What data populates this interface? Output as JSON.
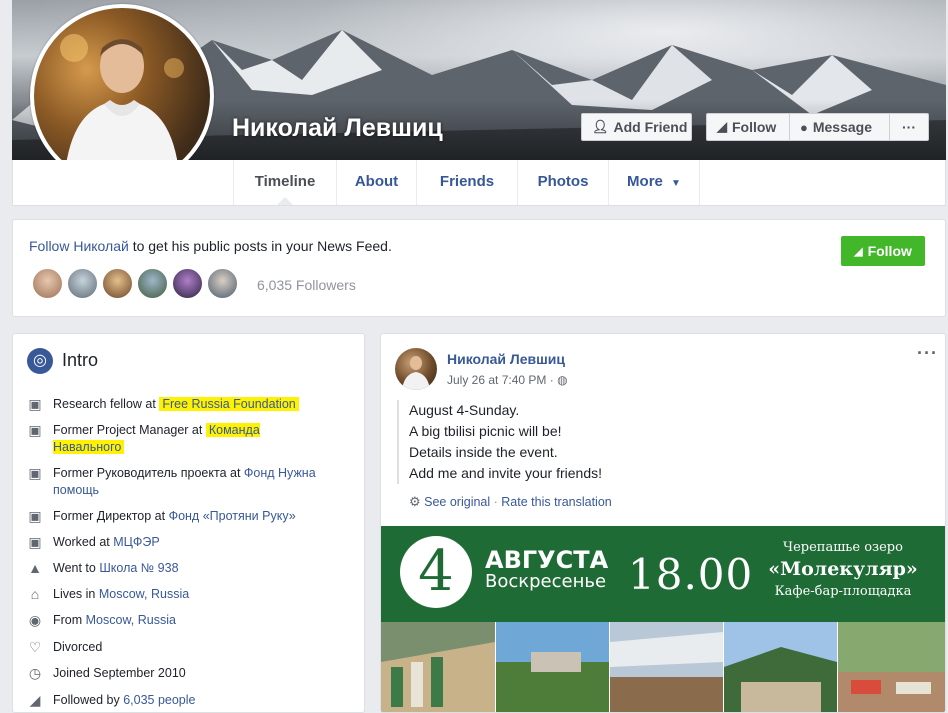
{
  "profile": {
    "name": "Николай Левшиц",
    "buttons": {
      "add_friend": "Add Friend",
      "follow": "Follow",
      "message": "Message",
      "more": "···"
    },
    "tabs": [
      {
        "label": "Timeline",
        "active": true
      },
      {
        "label": "About"
      },
      {
        "label": "Friends"
      },
      {
        "label": "Photos"
      },
      {
        "label": "More"
      }
    ]
  },
  "follow_card": {
    "link_text": "Follow Николай",
    "rest_text": " to get his public posts in your News Feed.",
    "button": "Follow",
    "followers": "6,035 Followers",
    "button_color": "#42b72a"
  },
  "intro": {
    "title": "Intro",
    "items": [
      {
        "icon": "briefcase-icon",
        "prefix": "Research fellow at ",
        "link": "Free Russia Foundation",
        "highlight": true
      },
      {
        "icon": "briefcase-icon",
        "prefix": "Former Project Manager at ",
        "link": "Команда Навального",
        "highlight": true
      },
      {
        "icon": "briefcase-icon",
        "prefix": "Former Руководитель проекта at ",
        "link": "Фонд Нужна помощь"
      },
      {
        "icon": "briefcase-icon",
        "prefix": "Former Директор at ",
        "link": "Фонд «Протяни Руку»"
      },
      {
        "icon": "briefcase-icon",
        "prefix": "Worked at ",
        "link": "МЦФЭР"
      },
      {
        "icon": "graduation-cap-icon",
        "prefix": "Went to ",
        "link": "Школа № 938"
      },
      {
        "icon": "house-icon",
        "prefix": "Lives in ",
        "link": "Moscow, Russia"
      },
      {
        "icon": "location-pin-icon",
        "prefix": "From ",
        "link": "Moscow, Russia"
      },
      {
        "icon": "heart-icon",
        "prefix": "Divorced",
        "link": ""
      },
      {
        "icon": "clock-icon",
        "prefix": "Joined September 2010",
        "link": ""
      },
      {
        "icon": "rss-icon",
        "prefix": "Followed by ",
        "link": "6,035 people"
      }
    ]
  },
  "post": {
    "author": "Николай Левшиц",
    "date": "July 26 at 7:40 PM · ",
    "lines": [
      "August 4-Sunday.",
      "A big tbilisi picnic will be!",
      "Details inside the event.",
      "Add me and invite your friends!"
    ],
    "see_original": "See original",
    "separator": " · ",
    "rate": "Rate this translation",
    "banner": {
      "day_number": "4",
      "month": "АВГУСТА",
      "weekday": "Воскресенье",
      "time": "18.00",
      "lake": "Черепашье озеро",
      "venue": "«Молекуляр»",
      "cafe": "Кафе-бар-площадка",
      "color": "#1f6b35"
    }
  }
}
